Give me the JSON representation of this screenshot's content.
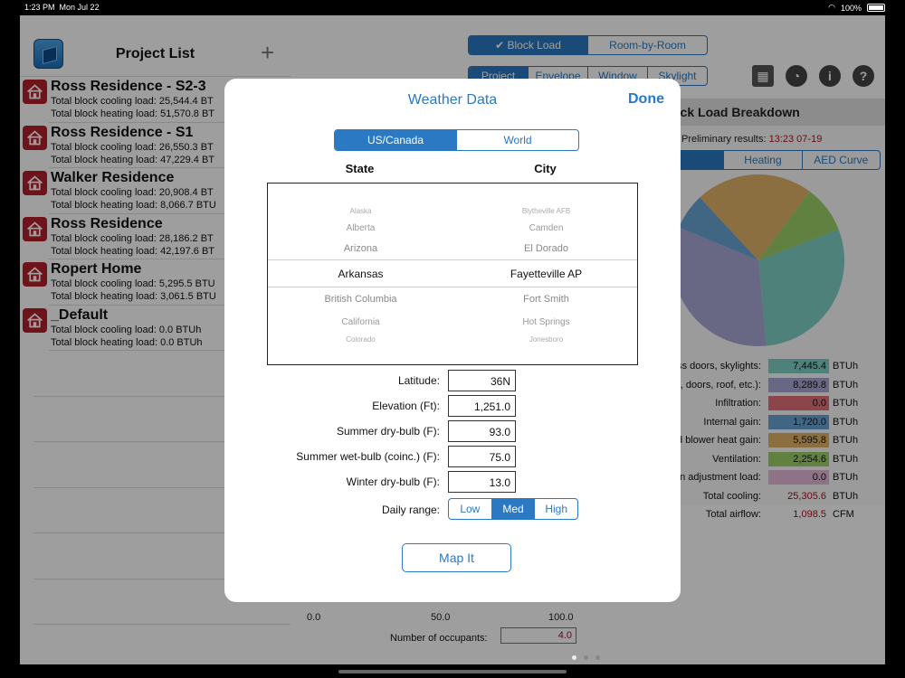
{
  "status": {
    "time": "1:23 PM",
    "date": "Mon Jul 22",
    "battery": "100%"
  },
  "sidebar": {
    "title": "Project List",
    "add_symbol": "+",
    "projects": [
      {
        "name": "Ross Residence - S2-3",
        "cooling": "Total block cooling load: 25,544.4 BT",
        "heating": "Total block heating load: 51,570.8 BT"
      },
      {
        "name": "Ross Residence - S1",
        "cooling": "Total block cooling load: 26,550.3 BT",
        "heating": "Total block heating load: 47,229.4 BT"
      },
      {
        "name": "Walker Residence",
        "cooling": "Total block cooling load: 20,908.4 BT",
        "heating": "Total block heating load: 8,066.7 BTU"
      },
      {
        "name": "Ross Residence",
        "cooling": "Total block cooling load: 28,186.2 BT",
        "heating": "Total block heating load: 42,197.6 BT"
      },
      {
        "name": "Ropert Home",
        "cooling": "Total block cooling load: 5,295.5 BTU",
        "heating": "Total block heating load: 3,061.5 BTU"
      },
      {
        "name": "_Default",
        "cooling": "Total block cooling load: 0.0 BTUh",
        "heating": "Total block heating load: 0.0 BTUh"
      }
    ]
  },
  "main": {
    "mode_tabs": [
      "Block Load",
      "Room-by-Room"
    ],
    "sub_tabs": [
      "Project",
      "Envelope",
      "Window",
      "Skylight"
    ],
    "breakdown_title": "ock Load Breakdown",
    "prelim_label": "Preliminary results:",
    "prelim_time": "13:23 07-19",
    "view_tabs": [
      "",
      "Heating",
      "AED Curve"
    ],
    "rows": [
      {
        "label": "ss doors, skylights:",
        "value": "7,445.4",
        "unit": "BTUh",
        "color": "#7fd1c4"
      },
      {
        "label": "s, doors, roof, etc.):",
        "value": "8,289.8",
        "unit": "BTUh",
        "color": "#a9a9d6"
      },
      {
        "label": "Infiltration:",
        "value": "0.0",
        "unit": "BTUh",
        "color": "#e0707a"
      },
      {
        "label": "Internal gain:",
        "value": "1,720.0",
        "unit": "BTUh",
        "color": "#6aa5d6"
      },
      {
        "label": "d blower heat gain:",
        "value": "5,595.8",
        "unit": "BTUh",
        "color": "#e3b46a"
      },
      {
        "label": "Ventilation:",
        "value": "2,254.6",
        "unit": "BTUh",
        "color": "#9dd168"
      },
      {
        "label": "on adjustment load:",
        "value": "0.0",
        "unit": "BTUh",
        "color": "#e6b8d8"
      },
      {
        "label": "Total cooling:",
        "value": "25,305.6",
        "unit": "BTUh",
        "color": "transparent"
      },
      {
        "label": "Total airflow:",
        "value": "1,098.5",
        "unit": "CFM",
        "color": "transparent"
      }
    ],
    "slider_ticks": [
      "0.0",
      "50.0",
      "100.0"
    ],
    "occupants_label": "Number of occupants:",
    "occupants_value": "4.0"
  },
  "modal": {
    "title": "Weather Data",
    "done_label": "Done",
    "region_tabs": [
      "US/Canada",
      "World"
    ],
    "state_header": "State",
    "city_header": "City",
    "states": [
      "Alaska",
      "Alberta",
      "Arizona",
      "Arkansas",
      "British Columbia",
      "California",
      "Colorado"
    ],
    "cities": [
      "Blytheville AFB",
      "Camden",
      "El Dorado",
      "Fayetteville AP",
      "Fort Smith",
      "Hot Springs",
      "Jonesboro"
    ],
    "fields": [
      {
        "label": "Latitude:",
        "value": "36N"
      },
      {
        "label": "Elevation (Ft):",
        "value": "1,251.0"
      },
      {
        "label": "Summer dry-bulb (F):",
        "value": "93.0"
      },
      {
        "label": "Summer wet-bulb (coinc.) (F):",
        "value": "75.0"
      },
      {
        "label": "Winter dry-bulb (F):",
        "value": "13.0"
      }
    ],
    "daily_range_label": "Daily range:",
    "daily_range_options": [
      "Low",
      "Med",
      "High"
    ],
    "map_button": "Map It"
  },
  "colors": {
    "accent": "#2a79c2",
    "project_icon": "#b3202a"
  },
  "chart_data": {
    "type": "pie",
    "values": [
      7445.4,
      8289.8,
      0.0,
      1720.0,
      5595.8,
      2254.6,
      0.0
    ],
    "colors": [
      "#7fd1c4",
      "#a9a9d6",
      "#e0707a",
      "#6aa5d6",
      "#e3b46a",
      "#9dd168",
      "#e6b8d8"
    ]
  }
}
